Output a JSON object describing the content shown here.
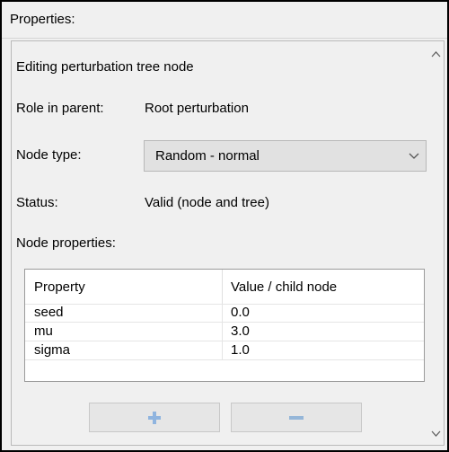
{
  "header": {
    "title": "Properties:"
  },
  "panel": {
    "heading": "Editing perturbation tree node",
    "role_label": "Role in parent:",
    "role_value": "Root perturbation",
    "node_type_label": "Node type:",
    "node_type_value": "Random - normal",
    "status_label": "Status:",
    "status_value": "Valid (node and tree)",
    "node_properties_label": "Node properties:"
  },
  "table": {
    "columns": [
      "Property",
      "Value / child node"
    ],
    "rows": [
      {
        "property": "seed",
        "value": "0.0"
      },
      {
        "property": "mu",
        "value": "3.0"
      },
      {
        "property": "sigma",
        "value": "1.0"
      }
    ]
  },
  "icons": {
    "add": "plus-icon",
    "remove": "minus-icon",
    "dropdown": "chevron-down-icon",
    "scroll_up": "scroll-up-arrow-icon",
    "scroll_down": "scroll-down-arrow-icon"
  },
  "colors": {
    "window_bg": "#f0f0f0",
    "table_bg": "#ffffff",
    "button_bg": "#e6e6e6",
    "plus_icon": "#8fb4df",
    "minus_icon": "#95b6d8",
    "frame_border": "#000000"
  }
}
